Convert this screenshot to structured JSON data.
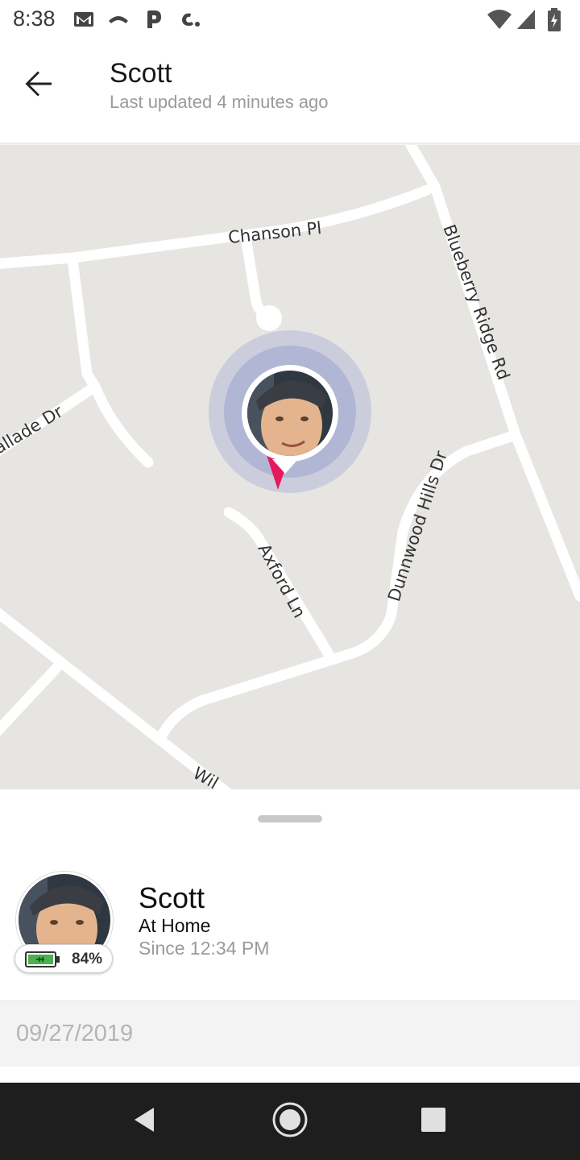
{
  "status_bar": {
    "time": "8:38",
    "icons": [
      "gmail-icon",
      "missed-call-icon",
      "p-app-icon",
      "c-app-icon",
      "wifi-icon",
      "cell-signal-icon",
      "battery-charging-icon"
    ]
  },
  "header": {
    "title": "Scott",
    "subtitle": "Last updated 4 minutes ago",
    "back_icon": "arrow-back-icon"
  },
  "map": {
    "streets": [
      "Chanson Pl",
      "Blueberry Ridge Rd",
      "allade Dr",
      "Dunnwood Hills Dr",
      "Axford Ln",
      "Wil"
    ],
    "marker_color": "#e6195f",
    "halo_color": "#9fa6cf",
    "fab_icon": "map-icon"
  },
  "member": {
    "name": "Scott",
    "place": "At Home",
    "since": "Since 12:34 PM",
    "battery_text": "84%",
    "battery_level": 0.84,
    "battery_color": "#4caf50"
  },
  "history": {
    "date": "09/27/2019"
  },
  "nav": {
    "icons": [
      "back-triangle-icon",
      "home-circle-icon",
      "recents-square-icon"
    ]
  }
}
